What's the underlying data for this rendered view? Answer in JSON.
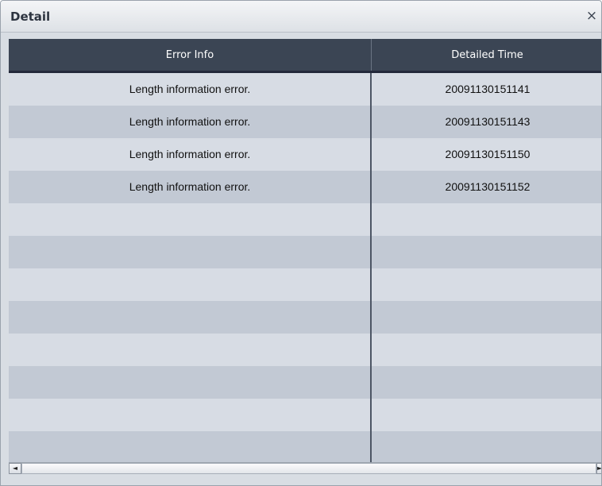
{
  "window": {
    "title": "Detail",
    "close_glyph": "×"
  },
  "table": {
    "columns": [
      "Error Info",
      "Detailed Time"
    ],
    "rows": [
      {
        "error_info": "Length information error.",
        "detailed_time": "20091130151141"
      },
      {
        "error_info": "Length information error.",
        "detailed_time": "20091130151143"
      },
      {
        "error_info": "Length information error.",
        "detailed_time": "20091130151150"
      },
      {
        "error_info": "Length information error.",
        "detailed_time": "20091130151152"
      },
      {
        "error_info": "",
        "detailed_time": ""
      },
      {
        "error_info": "",
        "detailed_time": ""
      },
      {
        "error_info": "",
        "detailed_time": ""
      },
      {
        "error_info": "",
        "detailed_time": ""
      },
      {
        "error_info": "",
        "detailed_time": ""
      },
      {
        "error_info": "",
        "detailed_time": ""
      },
      {
        "error_info": "",
        "detailed_time": ""
      },
      {
        "error_info": "",
        "detailed_time": ""
      }
    ]
  },
  "scrollbar": {
    "left_arrow_glyph": "◄",
    "right_arrow_glyph": "►"
  },
  "colors": {
    "header_bg": "#3b4554",
    "row_light": "#d7dce4",
    "row_dark": "#c2c9d4"
  }
}
